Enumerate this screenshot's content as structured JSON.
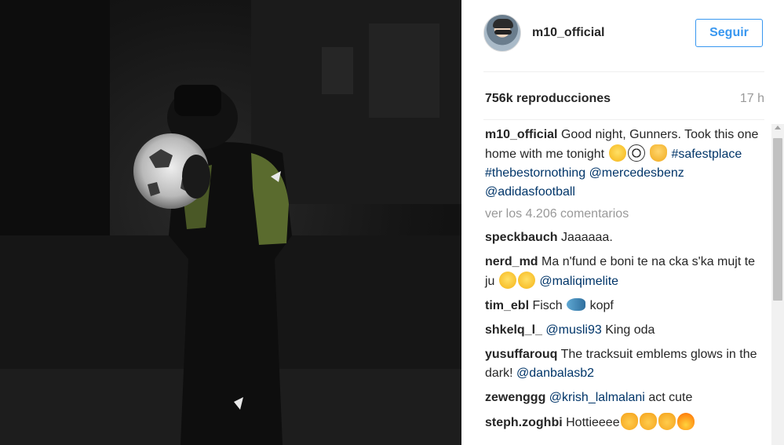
{
  "post": {
    "username": "m10_official",
    "follow_label": "Seguir",
    "views": "756k reproducciones",
    "time": "17 h"
  },
  "caption": {
    "user": "m10_official",
    "text1": "Good night, Gunners. Took this one home with me tonight",
    "tags": "#safestplace #thebestornothing",
    "mentions": "@mercedesbenz @adidasfootball"
  },
  "view_more": "ver los 4.206 comentarios",
  "comments": [
    {
      "user": "speckbauch",
      "text": "Jaaaaaa."
    },
    {
      "user": "nerd_md",
      "text": "Ma n'fund e boni te na cka s'ka mujt te ju",
      "mention": "@maliqimelite"
    },
    {
      "user": "tim_ebl",
      "text": "Fisch",
      "text2": "kopf"
    },
    {
      "user": "shkelq_l_",
      "mention": "@musli93",
      "text": "King oda"
    },
    {
      "user": "yusuffarouq",
      "text": "The tracksuit emblems glows in the dark!",
      "mention": "@danbalasb2"
    },
    {
      "user": "zewenggg",
      "mention": "@krish_lalmalani",
      "text": "act cute"
    },
    {
      "user": "steph.zoghbi",
      "text": "Hottieeee"
    }
  ],
  "icons": {
    "wink": "winking-face-tongue-icon",
    "ball": "soccer-ball-icon",
    "ok": "ok-hand-icon",
    "fish": "fish-icon",
    "cat": "cat-face-icon",
    "fire": "fire-icon"
  },
  "colors": {
    "accent": "#3897f0",
    "link": "#003569",
    "muted": "#999999",
    "text": "#262626"
  }
}
